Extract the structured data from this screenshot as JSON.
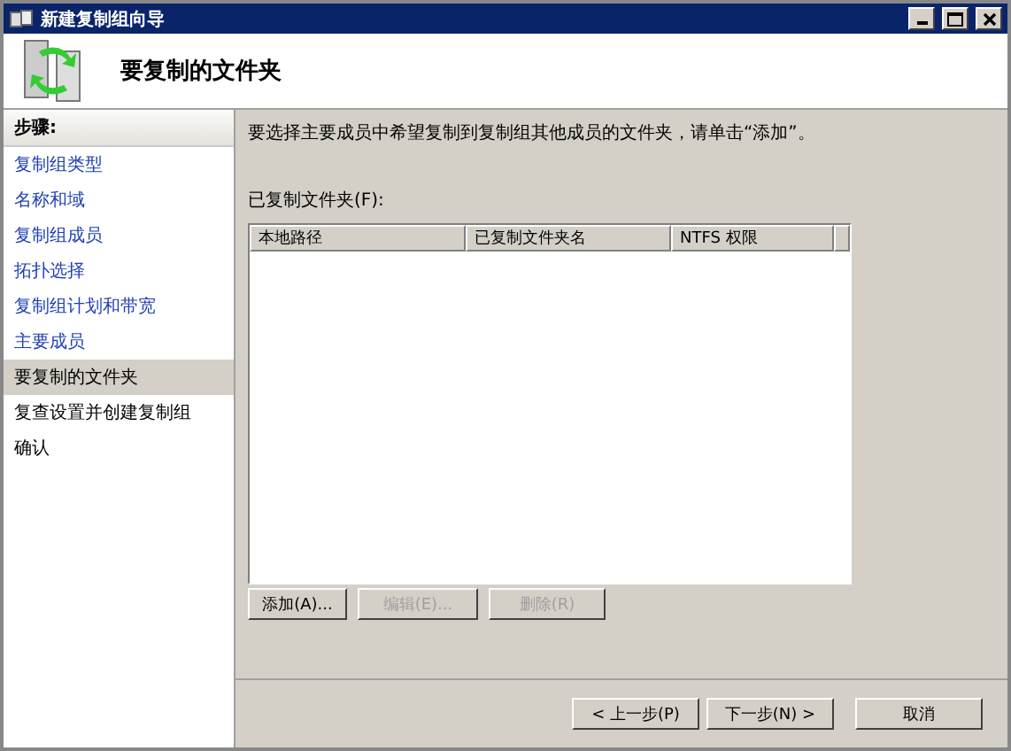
{
  "window": {
    "title": "新建复制组向导"
  },
  "header": {
    "title": "要复制的文件夹"
  },
  "sidebar": {
    "heading": "步骤:",
    "items": [
      {
        "label": "复制组类型",
        "visited": true,
        "selected": false
      },
      {
        "label": "名称和域",
        "visited": true,
        "selected": false
      },
      {
        "label": "复制组成员",
        "visited": true,
        "selected": false
      },
      {
        "label": "拓扑选择",
        "visited": true,
        "selected": false
      },
      {
        "label": "复制组计划和带宽",
        "visited": true,
        "selected": false
      },
      {
        "label": "主要成员",
        "visited": true,
        "selected": false
      },
      {
        "label": "要复制的文件夹",
        "visited": false,
        "selected": true
      },
      {
        "label": "复查设置并创建复制组",
        "visited": false,
        "selected": false
      },
      {
        "label": "确认",
        "visited": false,
        "selected": false
      }
    ]
  },
  "content": {
    "instruction": "要选择主要成员中希望复制到复制组其他成员的文件夹，请单击“添加”。",
    "list_label": "已复制文件夹(F):",
    "table": {
      "columns": [
        "本地路径",
        "已复制文件夹名",
        "NTFS 权限"
      ]
    },
    "buttons": [
      {
        "label": "添加(A)...",
        "disabled": false
      },
      {
        "label": "编辑(E)...",
        "disabled": true
      },
      {
        "label": "删除(R)",
        "disabled": true
      }
    ]
  },
  "footer": {
    "buttons": [
      {
        "label": "< 上一步(P)",
        "disabled": false
      },
      {
        "label": "下一步(N) >",
        "disabled": false
      },
      {
        "label": "取消",
        "disabled": false
      }
    ]
  }
}
